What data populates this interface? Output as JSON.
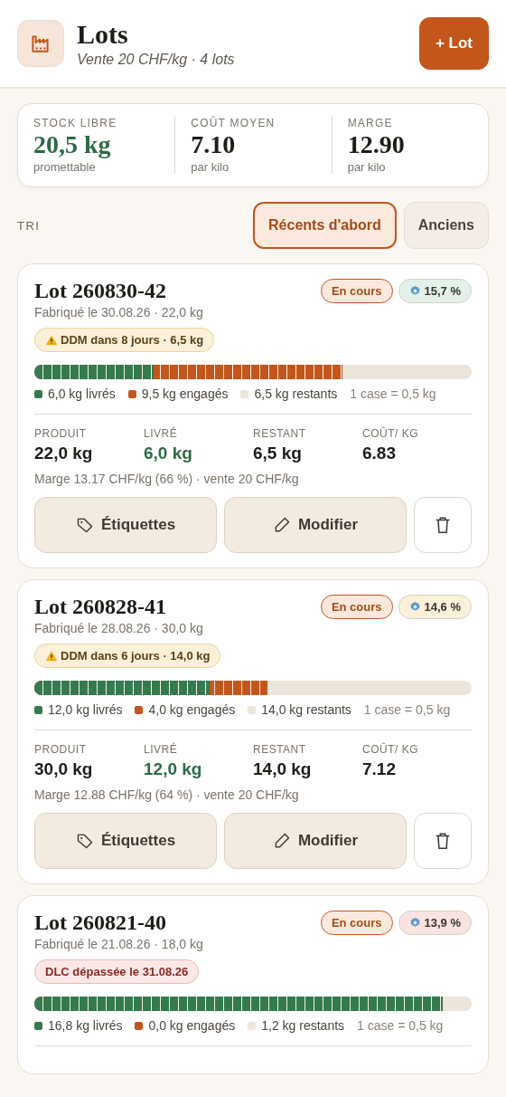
{
  "header": {
    "title": "Lots",
    "subtitle": "Vente 20 CHF/kg · 4 lots",
    "add_button": "+ Lot"
  },
  "summary": [
    {
      "label": "STOCK LIBRE",
      "value": "20,5 kg",
      "note": "promettable",
      "kind": "positive"
    },
    {
      "label": "COÛT MOYEN",
      "value": "7.10",
      "note": "par kilo",
      "kind": "plain"
    },
    {
      "label": "MARGE",
      "value": "12.90",
      "note": "par kilo",
      "kind": "plain"
    }
  ],
  "sort": {
    "label": "TRI",
    "options": [
      {
        "label": "Récents d'abord",
        "selected": true
      },
      {
        "label": "Anciens",
        "selected": false
      }
    ]
  },
  "lots": [
    {
      "title": "Lot 260830-42",
      "subtitle": "Fabriqué le 30.08.26 · 22,0 kg",
      "status": "En cours",
      "rate": {
        "text": "15,7 %",
        "color": "#e3f1ea"
      },
      "alert": {
        "kind": "warning",
        "text": "DDM dans 8 jours · 6,5 kg"
      },
      "bar": {
        "delivered": {
          "level": 0.273
        },
        "delivered_and_engaged": {
          "level": 0.705
        }
      },
      "legend": {
        "delivered": "6,0 kg livrés",
        "engaged": "9,5 kg engagés",
        "remaining": "6,5 kg restants",
        "scale": "1 case = 0,5 kg"
      },
      "stats": [
        {
          "label": "PRODUIT",
          "value": "22,0 kg",
          "kind": "plain"
        },
        {
          "label": "LIVRÉ",
          "value": "6,0 kg",
          "kind": "positive"
        },
        {
          "label": "RESTANT",
          "value": "6,5 kg",
          "kind": "plain"
        },
        {
          "label": "COÛT/ KG",
          "value": "6.83",
          "kind": "plain"
        }
      ],
      "margin": "Marge 13.17 CHF/kg (66 %) · vente 20 CHF/kg",
      "actions": {
        "labels": "Étiquettes",
        "edit": "Modifier"
      }
    },
    {
      "title": "Lot 260828-41",
      "subtitle": "Fabriqué le 28.08.26 · 30,0 kg",
      "status": "En cours",
      "rate": {
        "text": "14,6 %",
        "color": "#fbf0da"
      },
      "alert": {
        "kind": "warning",
        "text": "DDM dans 6 jours · 14,0 kg"
      },
      "bar": {
        "delivered": {
          "level": 0.4
        },
        "delivered_and_engaged": {
          "level": 0.533
        }
      },
      "legend": {
        "delivered": "12,0 kg livrés",
        "engaged": "4,0 kg engagés",
        "remaining": "14,0 kg restants",
        "scale": "1 case = 0,5 kg"
      },
      "stats": [
        {
          "label": "PRODUIT",
          "value": "30,0 kg",
          "kind": "plain"
        },
        {
          "label": "LIVRÉ",
          "value": "12,0 kg",
          "kind": "positive"
        },
        {
          "label": "RESTANT",
          "value": "14,0 kg",
          "kind": "plain"
        },
        {
          "label": "COÛT/ KG",
          "value": "7.12",
          "kind": "plain"
        }
      ],
      "margin": "Marge 12.88 CHF/kg (64 %) · vente 20 CHF/kg",
      "actions": {
        "labels": "Étiquettes",
        "edit": "Modifier"
      }
    },
    {
      "title": "Lot 260821-40",
      "subtitle": "Fabriqué le 21.08.26 · 18,0 kg",
      "status": "En cours",
      "rate": {
        "text": "13,9 %",
        "color": "#f9e3e1"
      },
      "alert": {
        "kind": "expired",
        "text": "DLC dépassée le 31.08.26"
      },
      "bar": {
        "delivered": {
          "level": 0.933
        },
        "delivered_and_engaged": {
          "level": 0.933
        }
      },
      "legend": {
        "delivered": "16,8 kg livrés",
        "engaged": "0,0 kg engagés",
        "remaining": "1,2 kg restants",
        "scale": "1 case = 0,5 kg"
      }
    }
  ]
}
